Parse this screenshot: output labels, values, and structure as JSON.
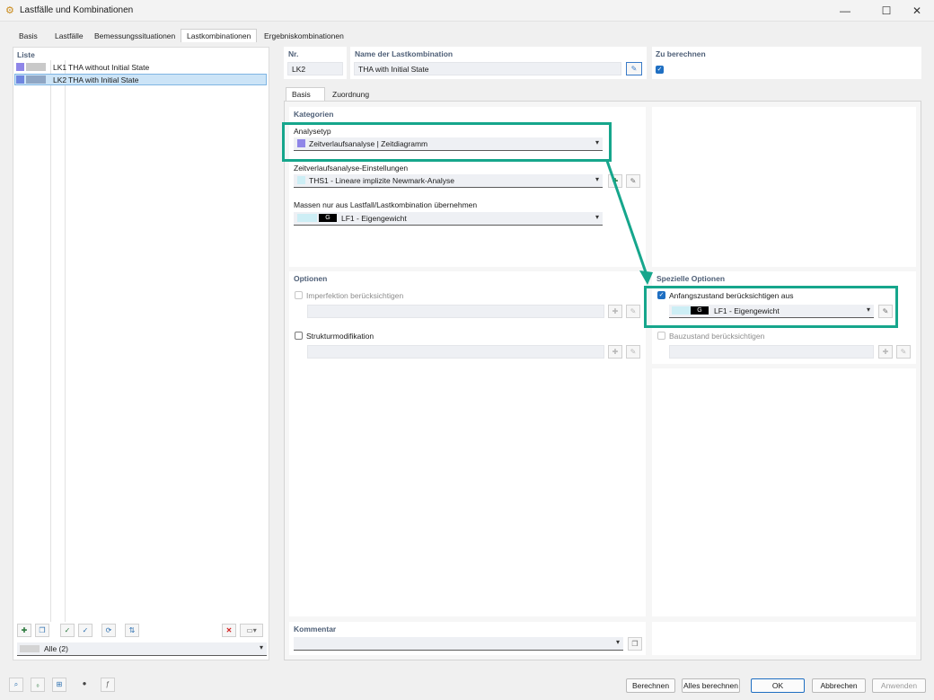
{
  "window": {
    "title": "Lastfälle und Kombinationen",
    "min": "—",
    "max": "☐",
    "close": "✕"
  },
  "tabs": [
    "Basis",
    "Lastfälle",
    "Bemessungssituationen",
    "Lastkombinationen",
    "Ergebniskombinationen"
  ],
  "list": {
    "title": "Liste",
    "items": [
      {
        "id": "LK1",
        "name": "THA without Initial State"
      },
      {
        "id": "LK2",
        "name": "THA with Initial State"
      }
    ],
    "filter": "Alle (2)"
  },
  "header": {
    "nr_label": "Nr.",
    "nr_value": "LK2",
    "name_label": "Name der Lastkombination",
    "name_value": "THA with Initial State",
    "calc_label": "Zu berechnen"
  },
  "subtabs": [
    "Basis",
    "Zuordnung"
  ],
  "kategorien": {
    "title": "Kategorien",
    "analysetyp_label": "Analysetyp",
    "analysetyp_value": "Zeitverlaufsanalyse | Zeitdiagramm",
    "settings_label": "Zeitverlaufsanalyse-Einstellungen",
    "settings_value": "THS1 - Lineare implizite Newmark-Analyse",
    "mass_label": "Massen nur aus Lastfall/Lastkombination übernehmen",
    "mass_badge": "G",
    "mass_value": "LF1 - Eigengewicht"
  },
  "optionen": {
    "title": "Optionen",
    "imperfection": "Imperfektion berücksichtigen",
    "struktur": "Strukturmodifikation"
  },
  "spezielle": {
    "title": "Spezielle Optionen",
    "anfang": "Anfangszustand berücksichtigen aus",
    "anfang_badge": "G",
    "anfang_value": "LF1 - Eigengewicht",
    "bauzustand": "Bauzustand berücksichtigen"
  },
  "kommentar": {
    "title": "Kommentar"
  },
  "buttons": {
    "berechnen": "Berechnen",
    "alles": "Alles berechnen",
    "ok": "OK",
    "abbrechen": "Abbrechen",
    "anwenden": "Anwenden"
  },
  "colors": {
    "accent": "#1f6fc2",
    "highlight": "#16a68c",
    "swatch": "#8f86e8",
    "selection": "#cce4f7"
  },
  "icons": {
    "dropdown": "▾",
    "check": "✓",
    "delete": "✕"
  }
}
